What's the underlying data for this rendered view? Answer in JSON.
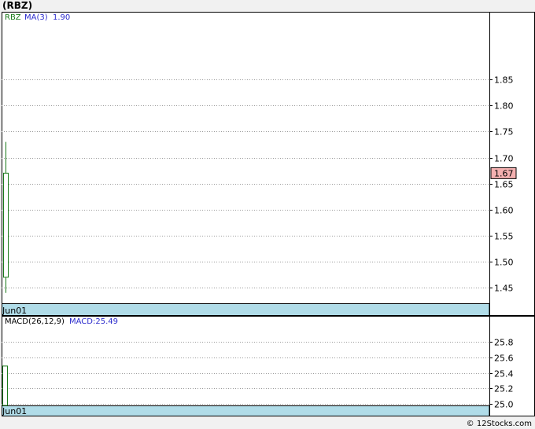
{
  "header": {
    "title": "(RBZ)"
  },
  "footer": {
    "copyright": "© 12Stocks.com"
  },
  "colors": {
    "price_candle": "#1a7a1a",
    "ma_label": "#2b2bcc",
    "ticker_label": "#1a7a1a",
    "last_price_bg": "#f4b0b0",
    "date_band": "#b0dce8",
    "grid": "#9a9a9a"
  },
  "chart_data": [
    {
      "type": "candlestick",
      "name": "price-panel",
      "legend": {
        "ticker": "RBZ",
        "ma_label": "MA(3)",
        "ma_value": "1.90"
      },
      "x": [
        "Jun01"
      ],
      "open": [
        1.47
      ],
      "high": [
        1.73
      ],
      "low": [
        1.44
      ],
      "close": [
        1.67
      ],
      "last_price": "1.67",
      "ylim": [
        1.42,
        1.98
      ],
      "yticks": [
        1.45,
        1.5,
        1.55,
        1.6,
        1.65,
        1.7,
        1.75,
        1.8,
        1.85
      ],
      "ytick_labels": [
        "1.45",
        "1.50",
        "1.55",
        "1.60",
        "1.65",
        "1.70",
        "1.75",
        "1.80",
        "1.85"
      ],
      "xtick_labels": [
        "Jun01"
      ],
      "grid": true
    },
    {
      "type": "bar",
      "name": "macd-panel",
      "legend": {
        "params": "MACD(26,12,9)",
        "value_label": "MACD:25.49"
      },
      "x": [
        "Jun01"
      ],
      "values": [
        25.49
      ],
      "ylim": [
        24.98,
        26.14
      ],
      "yticks": [
        25.0,
        25.2,
        25.4,
        25.6,
        25.8
      ],
      "ytick_labels": [
        "25.0",
        "25.2",
        "25.4",
        "25.6",
        "25.8"
      ],
      "xtick_labels": [
        "Jun01"
      ],
      "grid": true
    }
  ]
}
